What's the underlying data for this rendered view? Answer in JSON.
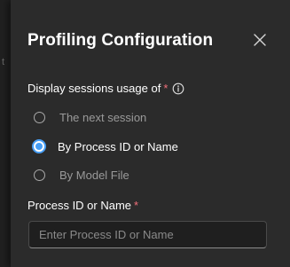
{
  "dialog": {
    "title": "Profiling Configuration"
  },
  "sessions_field": {
    "label": "Display sessions usage of",
    "required_mark": "*",
    "options": [
      {
        "label": "The next session",
        "selected": false
      },
      {
        "label": "By Process ID or Name",
        "selected": true
      },
      {
        "label": "By Model File",
        "selected": false
      }
    ]
  },
  "process_field": {
    "label": "Process ID or Name",
    "required_mark": "*",
    "value": "",
    "placeholder": "Enter Process ID or Name"
  },
  "backdrop": {
    "partial_text": "t"
  },
  "icons": {
    "close": "close-icon",
    "info": "info-icon"
  },
  "colors": {
    "panel_bg": "#2b2b2b",
    "accent": "#479ef5",
    "required": "#f1707b"
  }
}
